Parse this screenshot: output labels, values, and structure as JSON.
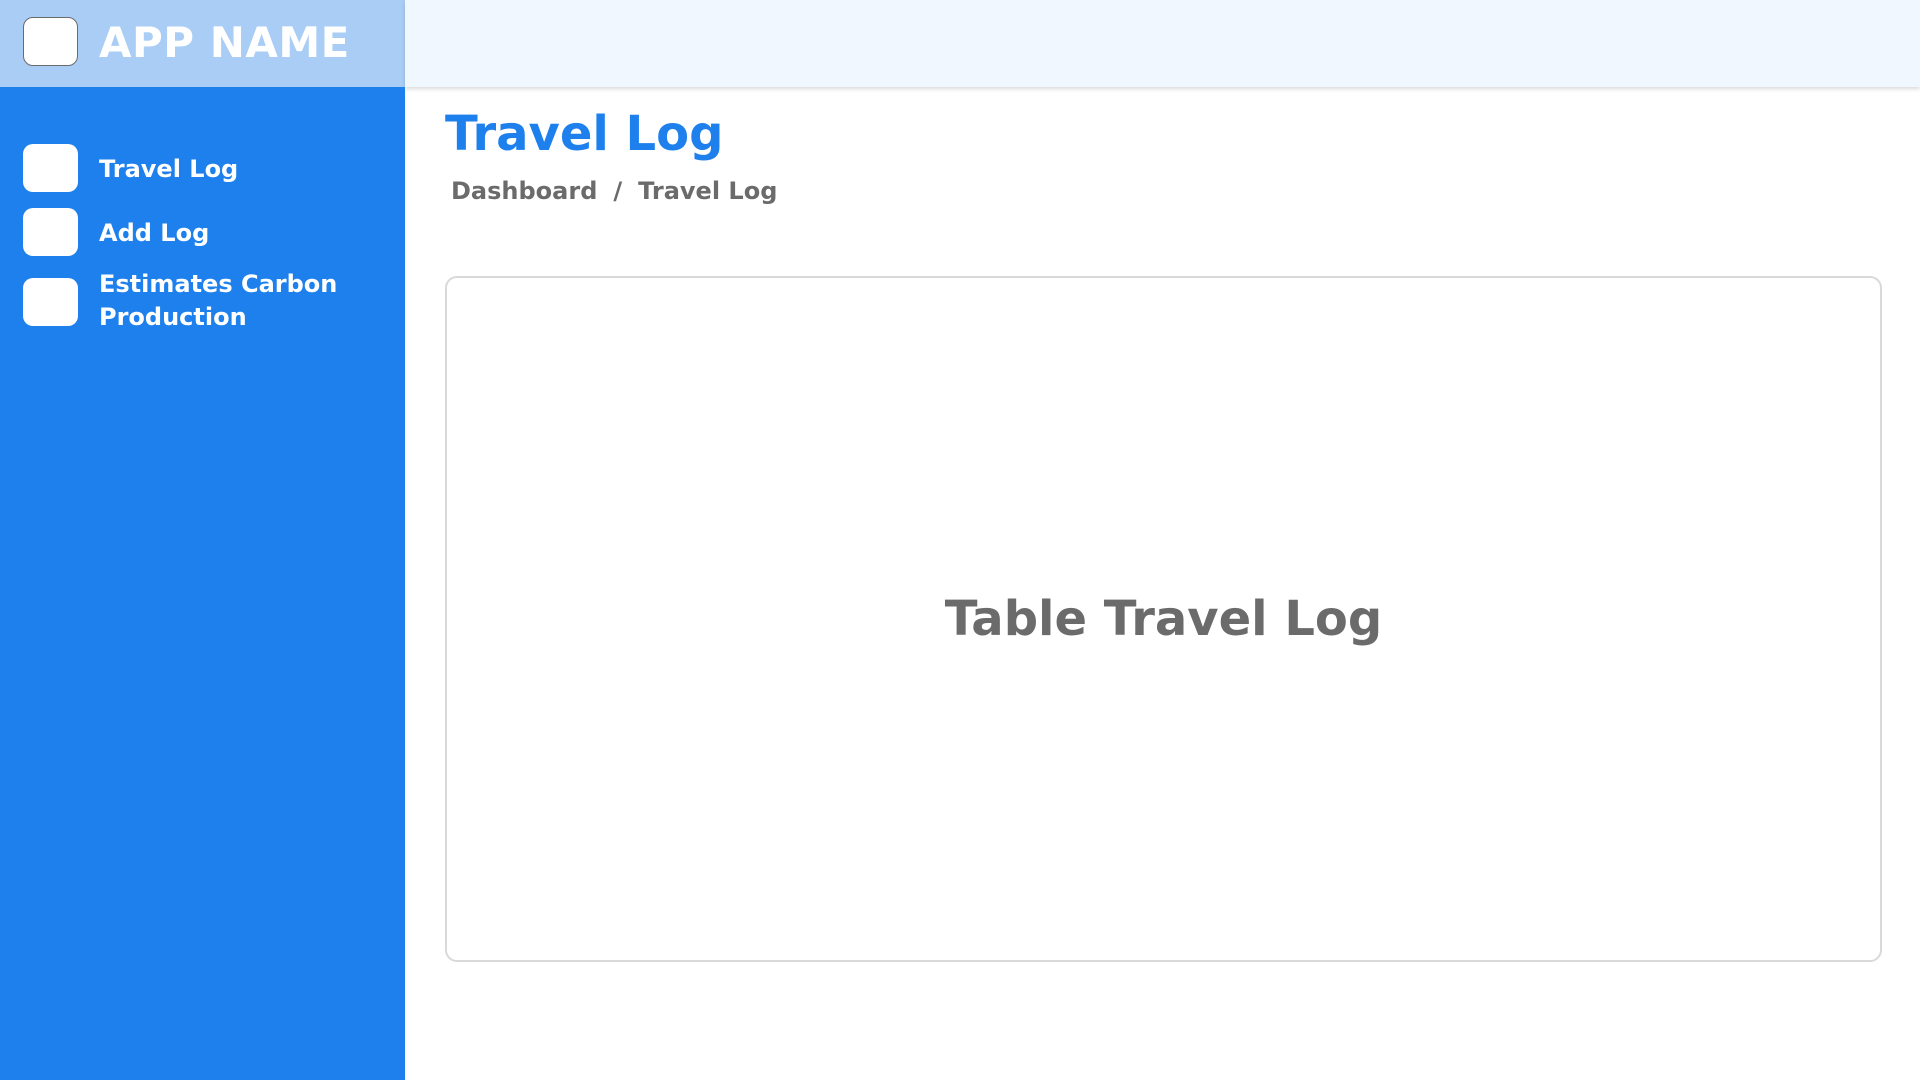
{
  "brand": {
    "app_name": "APP NAME"
  },
  "sidebar": {
    "items": [
      {
        "label": "Travel Log"
      },
      {
        "label": "Add Log"
      },
      {
        "label": "Estimates Carbon Production"
      }
    ]
  },
  "page": {
    "title": "Travel Log",
    "breadcrumb": [
      {
        "label": "Dashboard"
      },
      {
        "label": "/"
      },
      {
        "label": "Travel Log"
      }
    ]
  },
  "main": {
    "table_placeholder": "Table Travel Log"
  },
  "colors": {
    "primary": "#1e80ed",
    "brand_bar": "#a9cdf4",
    "topbar": "#f0f7ff",
    "muted_text": "#6b6b6b"
  }
}
